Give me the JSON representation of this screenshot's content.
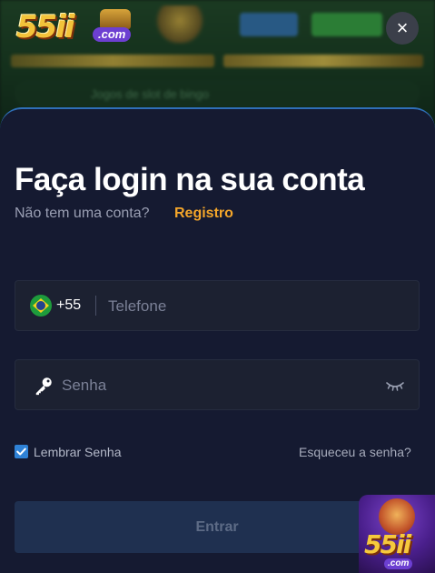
{
  "background": {
    "logo_text": "55ii",
    "logo_domain": ".com",
    "search_placeholder": "Jogos de slot de bingo"
  },
  "header": {
    "close_label": "×"
  },
  "login": {
    "title": "Faça login na sua conta",
    "no_account_text": "Não tem uma conta?",
    "register_link": "Registro",
    "phone": {
      "country_flag": "brazil-flag-icon",
      "prefix": "+55",
      "placeholder": "Telefone",
      "value": ""
    },
    "password": {
      "placeholder": "Senha",
      "value": ""
    },
    "remember_label": "Lembrar Senha",
    "remember_checked": true,
    "forgot_link": "Esqueceu a senha?",
    "submit_label": "Entrar"
  },
  "promo_badge": {
    "text": "55ii",
    "domain": ".com"
  },
  "colors": {
    "sheet_bg": "#151a31",
    "accent_orange": "#f4a62a",
    "accent_blue": "#2f82d6",
    "button_disabled_bg": "#1f3050"
  }
}
